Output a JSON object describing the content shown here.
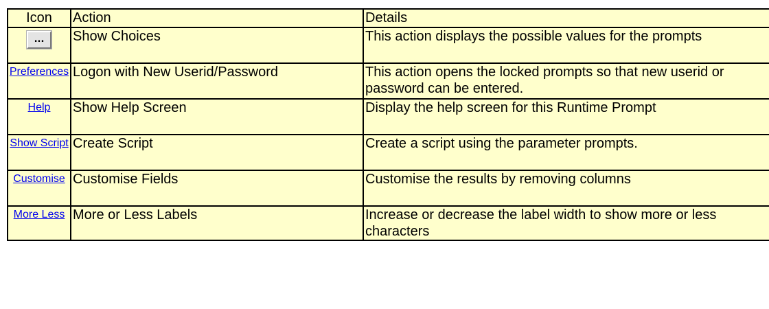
{
  "table": {
    "headers": {
      "icon": "Icon",
      "action": "Action",
      "details": "Details"
    },
    "rows": [
      {
        "icon_type": "button",
        "icon_text": "...",
        "icon_name": "ellipsis-button-icon",
        "action": "Show Choices",
        "details": "This action displays the possible values for the prompts"
      },
      {
        "icon_type": "link",
        "icon_text": "Preferences",
        "action": "Logon with New Userid/Password",
        "details": "This action opens the locked prompts so that new userid or password can be entered."
      },
      {
        "icon_type": "link",
        "icon_text": "Help",
        "action": "Show Help Screen",
        "details": "Display the help screen for this Runtime Prompt"
      },
      {
        "icon_type": "link",
        "icon_text": "Show Script",
        "action": "Create Script",
        "details": "Create a script using the parameter prompts."
      },
      {
        "icon_type": "link",
        "icon_text": "Customise",
        "action": "Customise Fields",
        "details": "Customise the results by removing columns"
      },
      {
        "icon_type": "link",
        "icon_text": "More Less",
        "action": "More or Less Labels",
        "details": "Increase or decrease the label width to show more or less characters"
      }
    ]
  },
  "colors": {
    "cell_background": "#ffffcc",
    "border": "#000000",
    "link": "#0000ee"
  }
}
